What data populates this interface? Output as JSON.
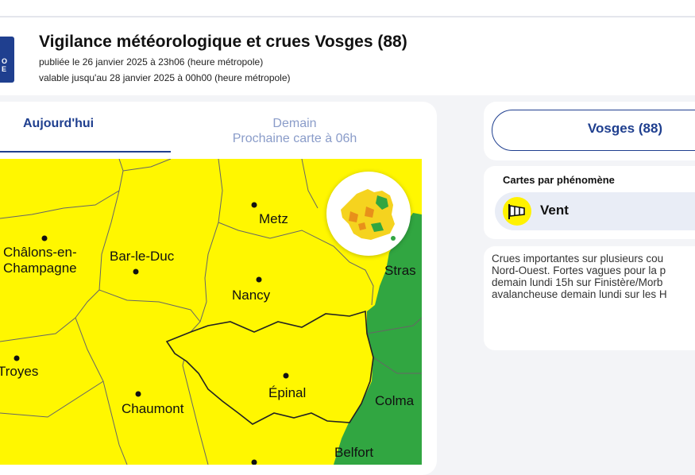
{
  "header": {
    "title": "Vigilance météorologique et crues Vosges (88)",
    "published": "publiée le 26 janvier 2025 à 23h06 (heure métropole)",
    "valid_until": "valable jusqu'au 28 janvier 2025 à 00h00 (heure métropole)",
    "logo_text": "O\nE"
  },
  "tabs": {
    "today": "Aujourd'hui",
    "tomorrow_line1": "Demain",
    "tomorrow_line2": "Prochaine carte à 06h"
  },
  "map": {
    "cities": [
      "Metz",
      "Châlons-en-",
      "Champagne",
      "Bar-le-Duc",
      "Nancy",
      "Stras",
      "Troyes",
      "Épinal",
      "Chaumont",
      "Colma",
      "Belfort"
    ],
    "colors": {
      "yellow": "#fff700",
      "green": "#31a641",
      "border": "#555555"
    }
  },
  "department": {
    "label": "Vosges (88)"
  },
  "phenomena": {
    "title": "Cartes par phénomène",
    "items": [
      {
        "label": "Vent",
        "icon": "wind-sock-icon",
        "color": "#fff200"
      }
    ]
  },
  "summary": {
    "lines": [
      "Crues importantes sur plusieurs cou",
      "Nord-Ouest. Fortes vagues pour la p",
      "demain lundi 15h sur Finistère/Morb",
      "avalancheuse demain lundi sur les H"
    ]
  },
  "accent_color": "#1f3f8f"
}
